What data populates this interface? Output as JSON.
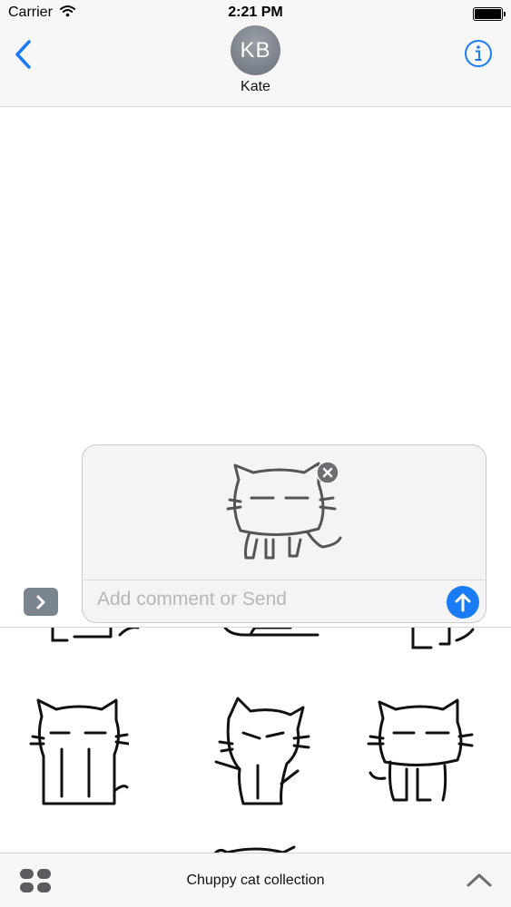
{
  "status_bar": {
    "carrier": "Carrier",
    "time": "2:21 PM",
    "icons": [
      "wifi-icon",
      "battery-icon"
    ]
  },
  "header": {
    "back_icon": "chevron-left-icon",
    "avatar_initials": "KB",
    "contact_name": "Kate",
    "info_icon": "info-icon"
  },
  "compose": {
    "expand_icon": "chevron-right-icon",
    "remove_icon": "close-icon",
    "placeholder": "Add comment or Send",
    "send_icon": "arrow-up-icon"
  },
  "drawer": {
    "collection_title": "Chuppy cat collection",
    "apps_icon": "app-grid-icon",
    "collapse_icon": "chevron-up-icon"
  },
  "colors": {
    "accent": "#1a7cf5",
    "bar_background": "#f7f7f7",
    "avatar_gray": "#7b8089"
  }
}
